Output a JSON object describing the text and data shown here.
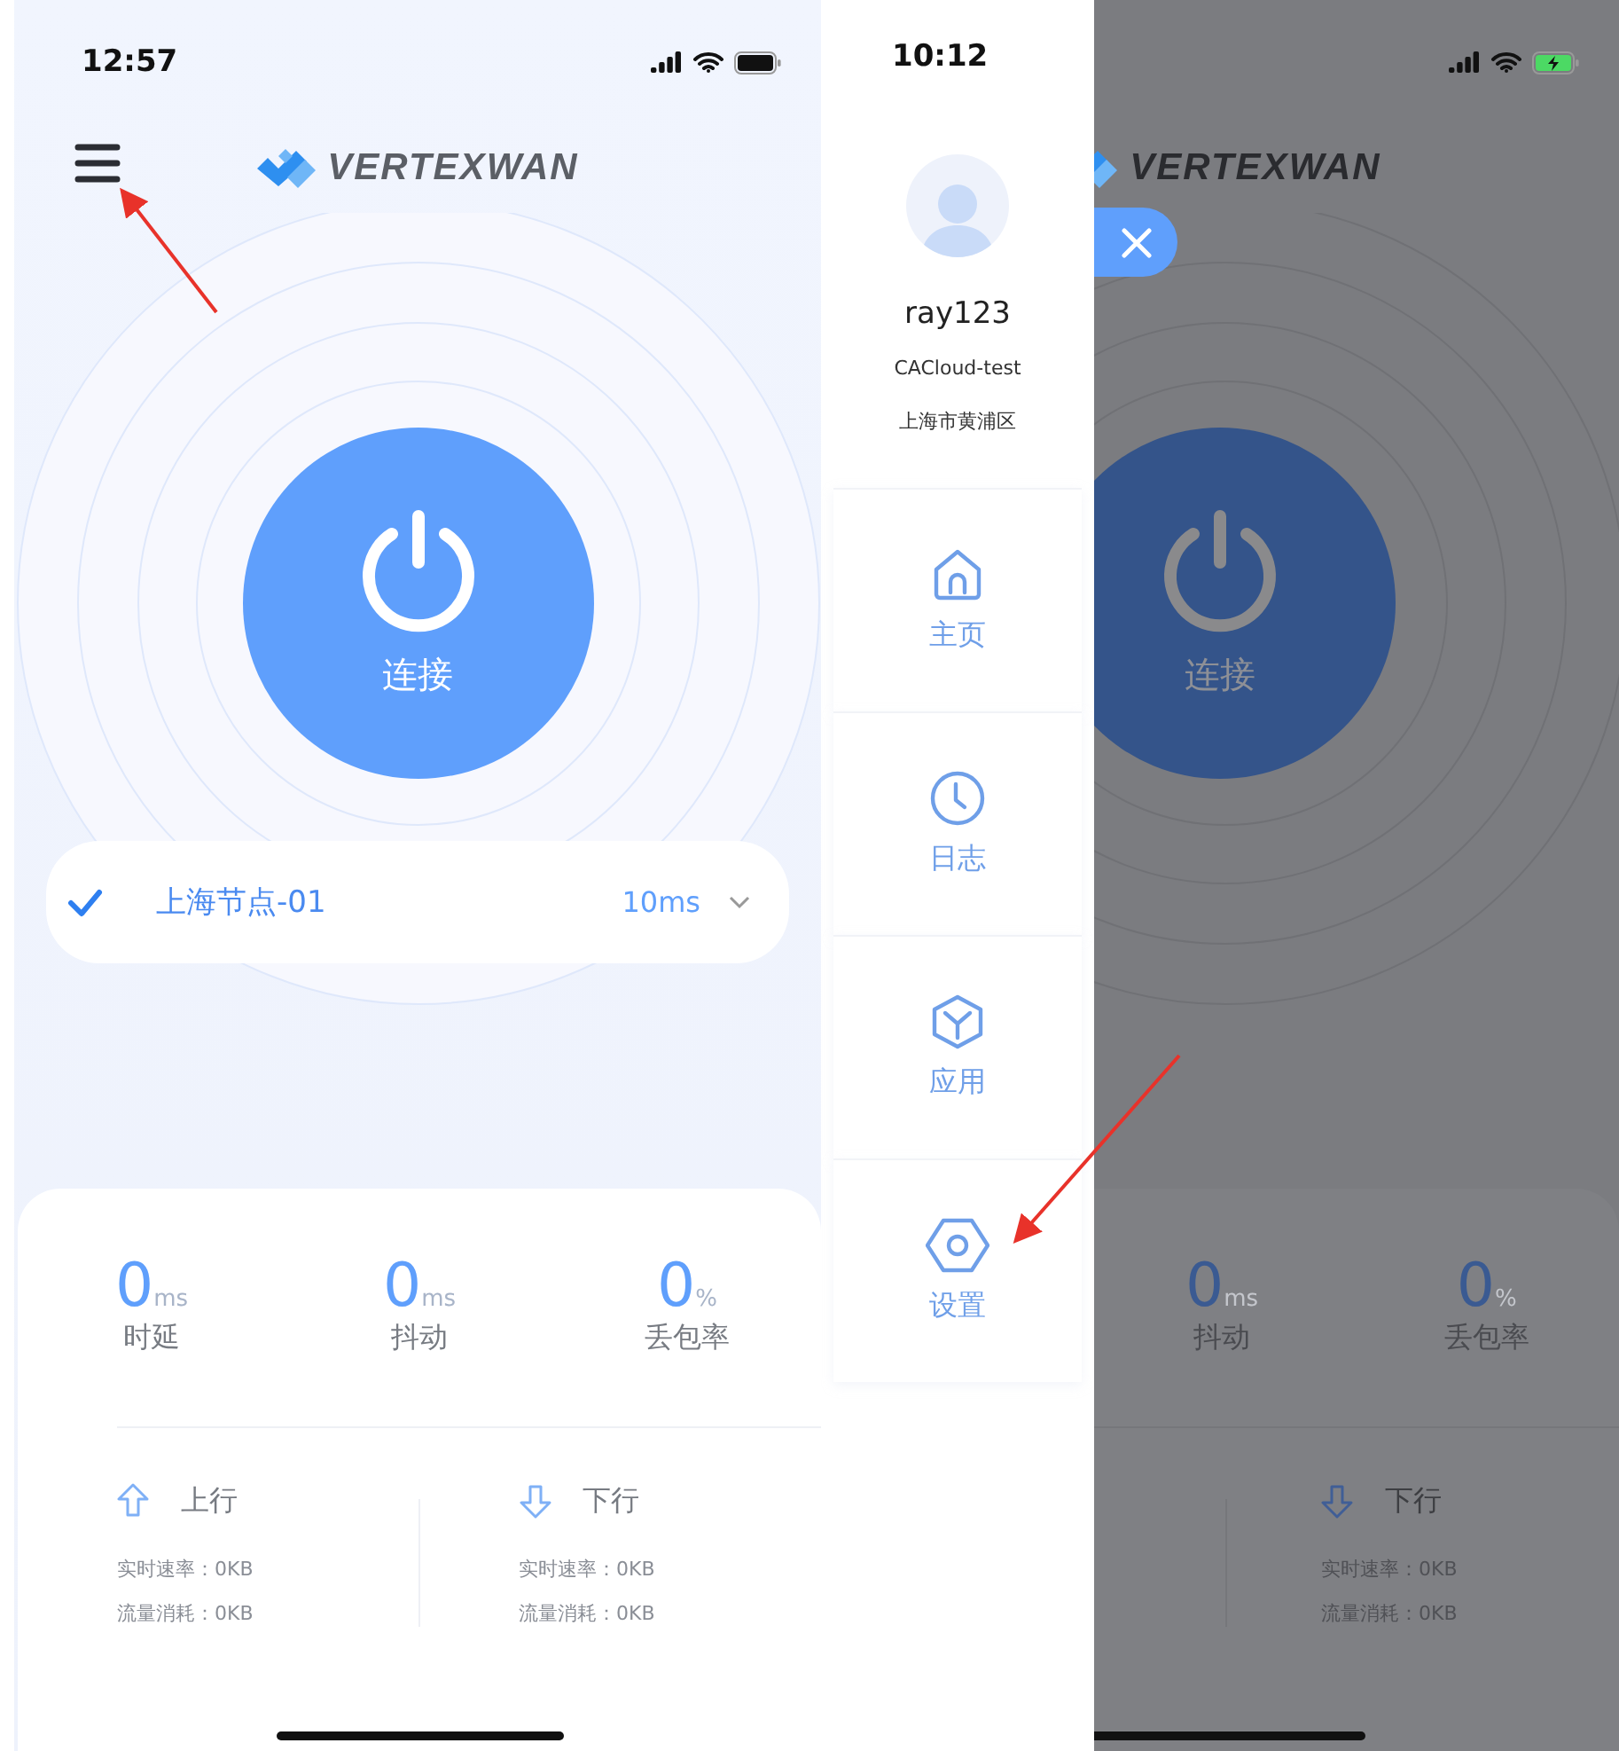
{
  "main_screen": {
    "status_bar": {
      "time": "12:57",
      "charging": false
    },
    "header": {
      "menu_button": true,
      "logo": "VERTEXWAN"
    },
    "connect_label": "连接",
    "node": {
      "name": "上海节点-01",
      "latency": "10ms",
      "selected": true
    },
    "stats": [
      {
        "value": "0",
        "unit": "ms",
        "label": "时延"
      },
      {
        "value": "0",
        "unit": "ms",
        "label": "抖动"
      },
      {
        "value": "0",
        "unit": "%",
        "label": "丢包率"
      }
    ],
    "traffic": [
      {
        "kind": "up",
        "title": "上行",
        "rows": [
          "实时速率：0KB",
          "流量消耗：0KB"
        ]
      },
      {
        "kind": "down",
        "title": "下行",
        "rows": [
          "实时速率：0KB",
          "流量消耗：0KB"
        ]
      }
    ]
  },
  "drawer_screen": {
    "status_bar": {
      "time": "10:12",
      "charging": true
    },
    "drawer": {
      "user": "ray123",
      "org": "CACloud-test",
      "location": "上海市黄浦区",
      "items": [
        {
          "kind": "home",
          "label": "主页"
        },
        {
          "kind": "log",
          "label": "日志"
        },
        {
          "kind": "apps",
          "label": "应用"
        },
        {
          "kind": "settings",
          "label": "设置"
        }
      ]
    },
    "background": {
      "header": {
        "logo": "VERTEXWAN"
      },
      "connect_label": "连接",
      "stats": [
        {
          "value": "0",
          "unit": "ms",
          "label": "抖动"
        },
        {
          "value": "0",
          "unit": "%",
          "label": "丢包率"
        }
      ],
      "traffic": [
        {
          "kind": "down",
          "title": "下行",
          "rows": [
            "实时速率：0KB",
            "流量消耗：0KB"
          ]
        }
      ]
    }
  }
}
